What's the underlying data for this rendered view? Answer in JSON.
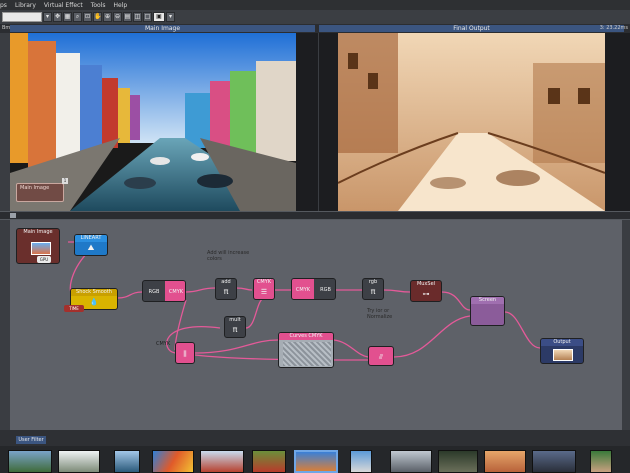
{
  "menubar": {
    "items": [
      "ps",
      "Library",
      "Virtual Effect",
      "Tools",
      "Help"
    ]
  },
  "toolbar": {
    "zoom_value": ""
  },
  "viewer": {
    "left_tab_label": "Bmc",
    "left_title": "Main Image",
    "right_title": "Final Output",
    "right_info": "3: 23.22ms"
  },
  "graph": {
    "nodes": {
      "main_image": "Main Image",
      "main_image_badge": "GPU",
      "lineart": "LINEART",
      "shock_smooth": "Shock Smooth",
      "time": "TIME",
      "rgb_cmyk_left": "RGB",
      "rgb_cmyk_right": "CMYK",
      "add": "add",
      "cmyk_small": "CMYK",
      "cmyk_rgb_left": "CMYK",
      "cmyk_rgb_right": "RGB",
      "rgb_pi": "rgb",
      "mult": "mult",
      "curves": "Curves CMYK",
      "muxsel": "MuxSel",
      "screen": "Screen",
      "output": "Output",
      "cmyk_split": "CMYK"
    },
    "notes": {
      "add_will_increase": "Add will increase\ncolors",
      "try_ior": "Try ior or\nNormalize"
    }
  },
  "filmstrip": {
    "tab_label": "User Filter"
  },
  "colors": {
    "accent_blue": "#3b5580",
    "node_pink": "#e2508f",
    "node_gray": "#3d4046",
    "node_yellow": "#d9b400",
    "node_blue": "#1f79c8",
    "node_maroon": "#6a2b2b",
    "node_purple": "#8b5c9a",
    "graph_bg": "#5e6168"
  }
}
